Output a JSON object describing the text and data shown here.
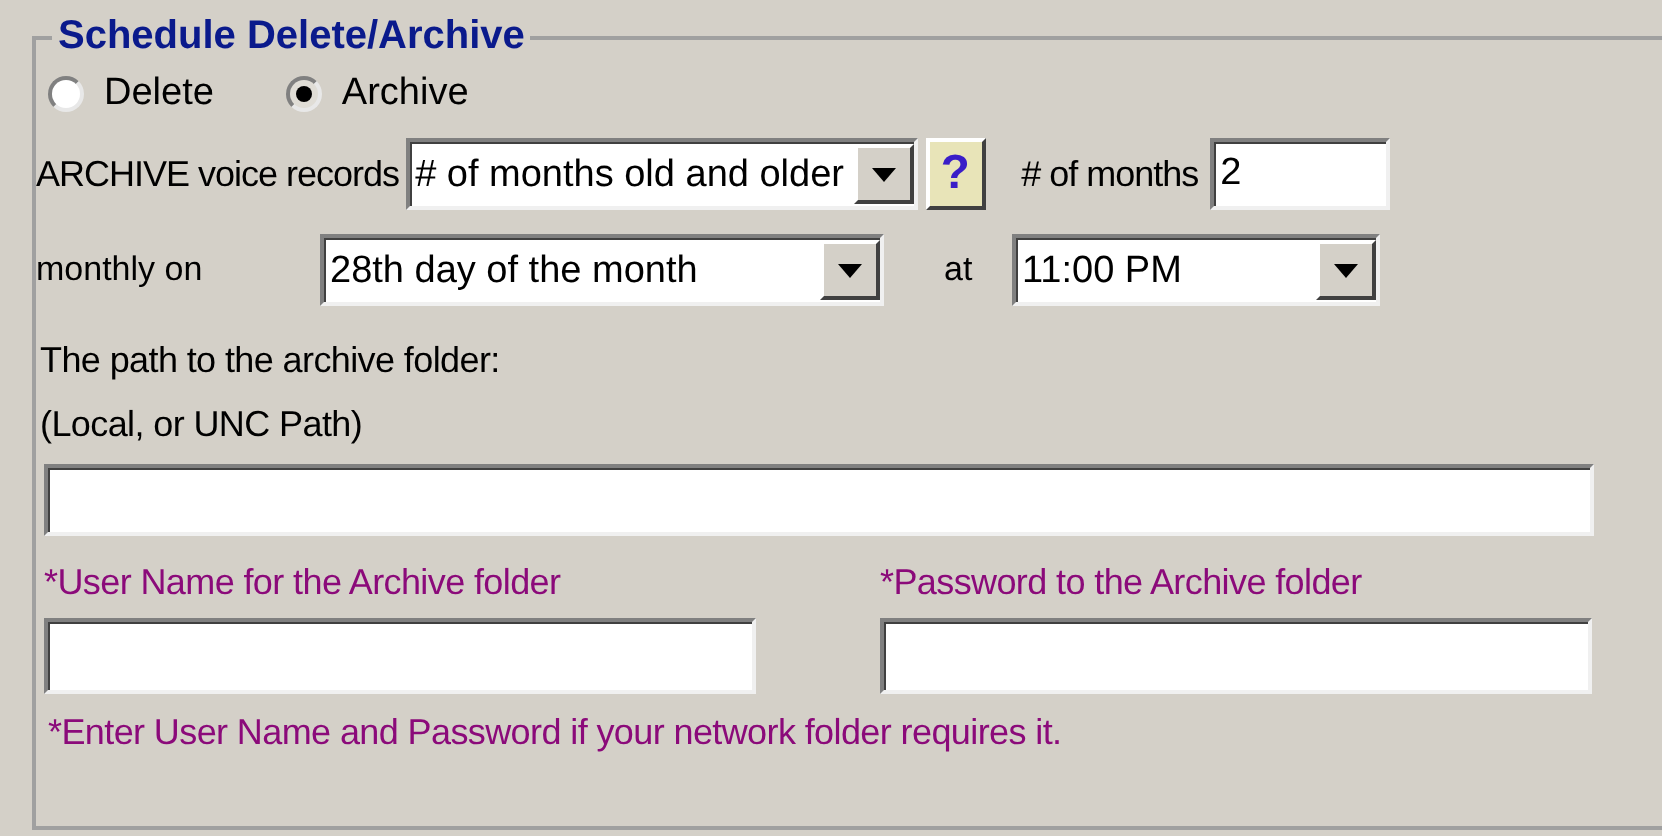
{
  "group": {
    "title": "Schedule Delete/Archive"
  },
  "modes": [
    {
      "label": "Delete",
      "selected": false
    },
    {
      "label": "Archive",
      "selected": true
    }
  ],
  "archive_row": {
    "label": "ARCHIVE voice records",
    "dropdown": {
      "value": "# of months old and older"
    },
    "help_button": "?",
    "months_label": "# of months",
    "months_field": {
      "value": "2"
    }
  },
  "schedule_row": {
    "label": "monthly on",
    "day_dropdown": {
      "value": "28th day of the month"
    },
    "at_label": "at",
    "time_dropdown": {
      "value": "11:00 PM"
    }
  },
  "path": {
    "label_lines": [
      "The path to the archive folder:",
      "(Local, or UNC Path)"
    ]
  },
  "credentials": {
    "user_label": "*User Name for the Archive folder",
    "password_label": "*Password to the Archive folder",
    "note": "*Enter User Name and Password if your network folder requires it."
  }
}
